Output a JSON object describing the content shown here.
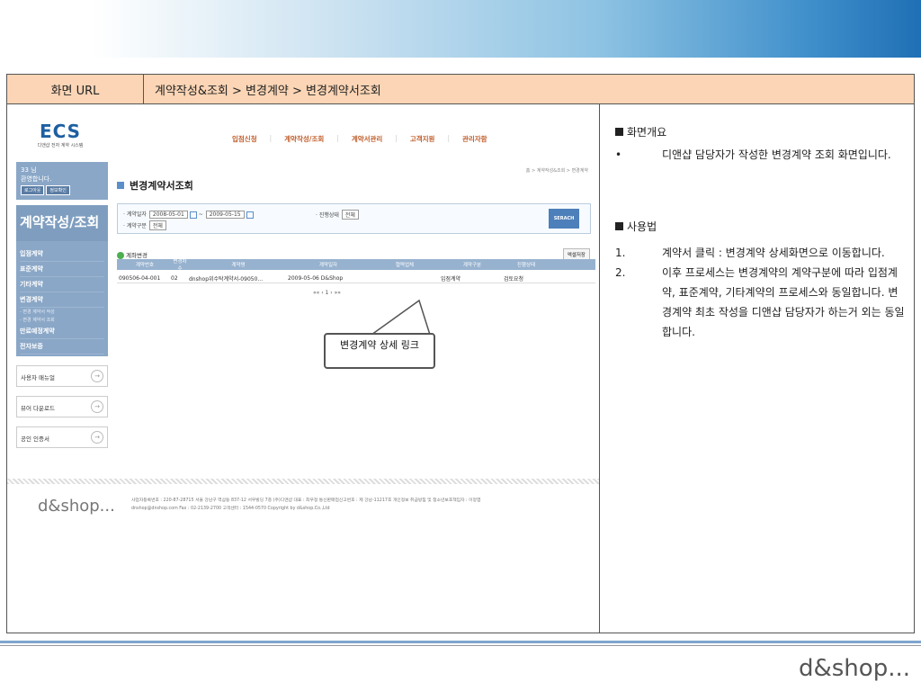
{
  "header": {
    "url_label": "화면 URL",
    "url_path": "계약작성&조회 > 변경계약 > 변경계약서조회"
  },
  "app": {
    "logo": "ECS",
    "logo_sub": "디앤샵 전자 계약 시스템",
    "nav": [
      "입점신청",
      "계약작성/조회",
      "계약서관리",
      "고객지원",
      "관리자함"
    ],
    "welcome": {
      "user": "33 님",
      "msg": "환영합니다.",
      "logout": "로그아웃",
      "info": "정보확인"
    },
    "side_title": "계약작성/조회",
    "menu": [
      "입점계약",
      "표준계약",
      "기타계약",
      "변경계약"
    ],
    "submenu": [
      "- 변경 계약서 작성",
      "- 변경 계약서 조회"
    ],
    "menu2": [
      "만료예정계약",
      "전자보증"
    ],
    "boxes": [
      "사용자 매뉴얼",
      "뷰어 다운로드",
      "공인 인증서"
    ],
    "crumb": "홈 > 계약작성&조회 > 변경계약",
    "page_title": "변경계약서조회",
    "search": {
      "date_label": "· 계약일자",
      "date_from": "2008-05-01",
      "tilde": "~",
      "date_to": "2009-05-15",
      "type_label": "· 계약구분",
      "type_value": "전체",
      "status_label": "· 진행상태",
      "status_value": "전체",
      "button": "SERACH"
    },
    "list_title": "계좌변경",
    "excel": "엑셀저장",
    "columns": [
      "계약번호",
      "변경차수",
      "계약명",
      "계약일자",
      "협력업체",
      "계약구분",
      "진행상태"
    ],
    "row": {
      "no": "090506-04-001",
      "rev": "02",
      "name": "dnshop위수탁계약서-09050...",
      "date": "2009-05-06",
      "partner": "D&Shop",
      "type": "입점계약",
      "status": "검토요청"
    },
    "pager": "«« ‹  1  › »»",
    "footer_logo": "d&shop...",
    "footer_l1": "사업자등록번호 : 220-87-28715  서울 강남구 역삼동 837-12 서우빌딩 7층 (주)디앤샵 대표 : 최우정 통신판매업신고번호 : 제 강남-11217호 개인정보 취급방침 및 청소년보호책임자 : 이정엽",
    "footer_l2": "dnshop@dnshop.com Fax : 02-2139-2700 고객센터 : 1544-0570 Copyright by d&shop.Co.,Ltd"
  },
  "callout": "변경계약 상세 링크",
  "panel": {
    "s1_title": "화면개요",
    "s1_bullet": "•",
    "s1_text": "디앤샵 담당자가 작성한 변경계약 조회 화면입니다.",
    "s2_title": "사용법",
    "s2_n1": "1.",
    "s2_t1": "계약서 클릭 : 변경계약 상세화면으로 이동합니다.",
    "s2_n2": "2.",
    "s2_t2": "이후 프로세스는 변경계약의 계약구분에 따라 입점계약, 표준계약, 기타계약의 프로세스와 동일합니다. 변경계약 최초 작성을 디앤샵 담당자가  하는거 외는 동일합니다."
  },
  "brand": "d&shop..."
}
